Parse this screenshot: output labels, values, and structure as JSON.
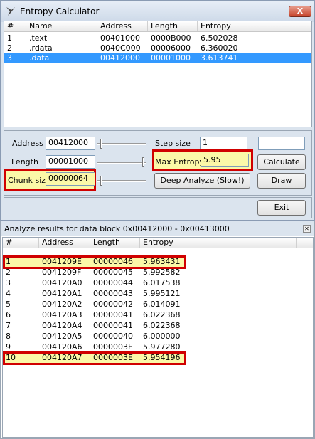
{
  "window": {
    "title": "Entropy Calculator",
    "close_label": "X"
  },
  "segments": {
    "columns": [
      "#",
      "Name",
      "Address",
      "Length",
      "Entropy"
    ],
    "rows": [
      {
        "n": "1",
        "name": ".text",
        "address": "00401000",
        "length": "0000B000",
        "entropy": "6.502028",
        "selected": false
      },
      {
        "n": "2",
        "name": ".rdata",
        "address": "0040C000",
        "length": "00006000",
        "entropy": "6.360020",
        "selected": false
      },
      {
        "n": "3",
        "name": ".data",
        "address": "00412000",
        "length": "00001000",
        "entropy": "3.613741",
        "selected": true
      }
    ]
  },
  "controls": {
    "address_label": "Address",
    "address_value": "00412000",
    "length_label": "Length",
    "length_value": "00001000",
    "chunk_label": "Chunk size",
    "chunk_value": "00000064",
    "step_label": "Step size",
    "step_value": "1",
    "max_entropy_label": "Max Entropy",
    "max_entropy_value": "5.95",
    "extra_value": "",
    "calculate_label": "Calculate",
    "deep_label": "Deep Analyze (Slow!)",
    "draw_label": "Draw",
    "exit_label": "Exit"
  },
  "results": {
    "title": "Analyze results for data block 0x00412000 - 0x00413000",
    "columns": [
      "#",
      "Address",
      "Length",
      "Entropy"
    ],
    "rows": [
      {
        "n": "1",
        "address": "0041209E",
        "length": "00000046",
        "entropy": "5.963431",
        "highlight": true
      },
      {
        "n": "2",
        "address": "0041209F",
        "length": "00000045",
        "entropy": "5.992582",
        "highlight": false
      },
      {
        "n": "3",
        "address": "004120A0",
        "length": "00000044",
        "entropy": "6.017538",
        "highlight": false
      },
      {
        "n": "4",
        "address": "004120A1",
        "length": "00000043",
        "entropy": "5.995121",
        "highlight": false
      },
      {
        "n": "5",
        "address": "004120A2",
        "length": "00000042",
        "entropy": "6.014091",
        "highlight": false
      },
      {
        "n": "6",
        "address": "004120A3",
        "length": "00000041",
        "entropy": "6.022368",
        "highlight": false
      },
      {
        "n": "7",
        "address": "004120A4",
        "length": "00000041",
        "entropy": "6.022368",
        "highlight": false
      },
      {
        "n": "8",
        "address": "004120A5",
        "length": "00000040",
        "entropy": "6.000000",
        "highlight": false
      },
      {
        "n": "9",
        "address": "004120A6",
        "length": "0000003F",
        "entropy": "5.977280",
        "highlight": false
      },
      {
        "n": "10",
        "address": "004120A7",
        "length": "0000003E",
        "entropy": "5.954196",
        "highlight": true
      }
    ]
  },
  "colors": {
    "selection": "#3399ff",
    "highlight_fill": "#fbf8a8",
    "highlight_border": "#d00000"
  }
}
